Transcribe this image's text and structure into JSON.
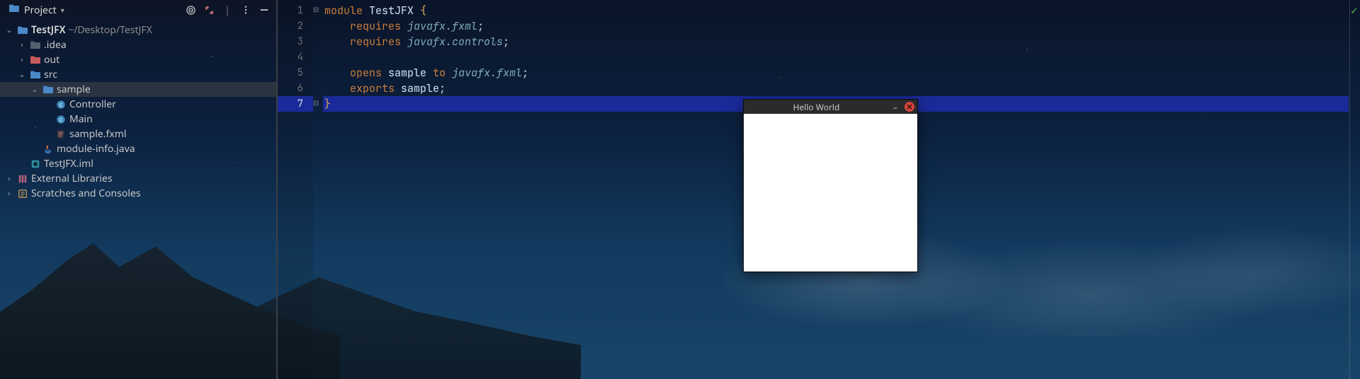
{
  "sidebar": {
    "header": {
      "label": "Project"
    },
    "root": {
      "name": "TestJFX",
      "path": "~/Desktop/TestJFX"
    },
    "nodes": {
      "idea": ".idea",
      "out": "out",
      "src": "src",
      "sample": "sample",
      "controller": "Controller",
      "main": "Main",
      "sample_fxml": "sample.fxml",
      "module_info": "module-info.java",
      "iml": "TestJFX.iml",
      "ext_lib": "External Libraries",
      "scratches": "Scratches and Consoles"
    }
  },
  "editor": {
    "lines": {
      "l1": {
        "kw": "module",
        "name": "TestJFX",
        "brace": "{"
      },
      "l2": {
        "kw": "requires",
        "pkg": "javafx.fxml",
        "end": ";"
      },
      "l3": {
        "kw": "requires",
        "pkg": "javafx.controls",
        "end": ";"
      },
      "l4": "",
      "l5": {
        "kw1": "opens",
        "name": "sample",
        "kw2": "to",
        "pkg": "javafx.fxml",
        "end": ";"
      },
      "l6": {
        "kw": "exports",
        "name": "sample",
        "end": ";"
      },
      "l7": {
        "brace": "}"
      }
    },
    "gutter": [
      "1",
      "2",
      "3",
      "4",
      "5",
      "6",
      "7"
    ],
    "current_line_index": 6
  },
  "popup": {
    "title": "Hello World",
    "minimize": "–"
  }
}
